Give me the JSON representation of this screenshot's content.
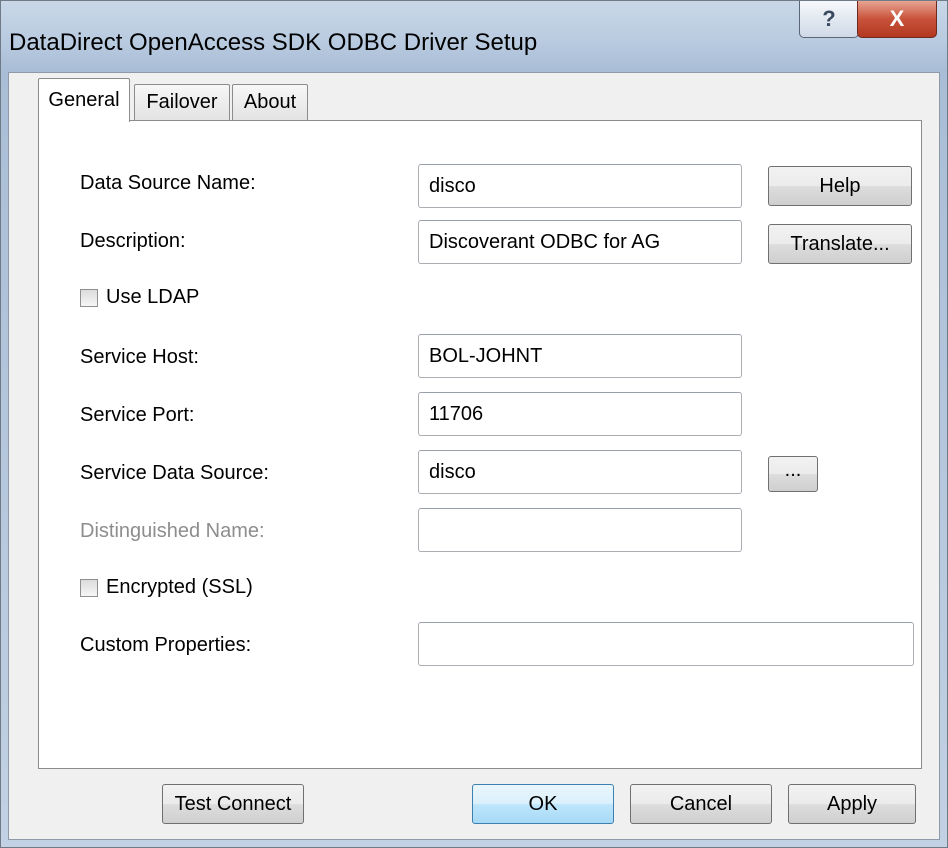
{
  "window": {
    "title": "DataDirect OpenAccess SDK ODBC Driver Setup",
    "help_glyph": "?",
    "close_glyph": "X"
  },
  "tabs": [
    {
      "label": "General",
      "active": true
    },
    {
      "label": "Failover",
      "active": false
    },
    {
      "label": "About",
      "active": false
    }
  ],
  "form": {
    "data_source_name": {
      "label": "Data Source Name:",
      "value": "disco"
    },
    "description": {
      "label": "Description:",
      "value": "Discoverant ODBC for AG"
    },
    "use_ldap": {
      "label": "Use LDAP",
      "checked": false
    },
    "service_host": {
      "label": "Service Host:",
      "value": "BOL-JOHNT"
    },
    "service_port": {
      "label": "Service Port:",
      "value": "11706"
    },
    "service_data_source": {
      "label": "Service Data Source:",
      "value": "disco"
    },
    "distinguished_name": {
      "label": "Distinguished Name:",
      "value": "",
      "disabled": true
    },
    "encrypted_ssl": {
      "label": "Encrypted (SSL)",
      "checked": false
    },
    "custom_properties": {
      "label": "Custom Properties:",
      "value": ""
    }
  },
  "side_buttons": {
    "help": "Help",
    "translate": "Translate...",
    "browse": "..."
  },
  "footer_buttons": {
    "test_connect": "Test Connect",
    "ok": "OK",
    "cancel": "Cancel",
    "apply": "Apply"
  }
}
